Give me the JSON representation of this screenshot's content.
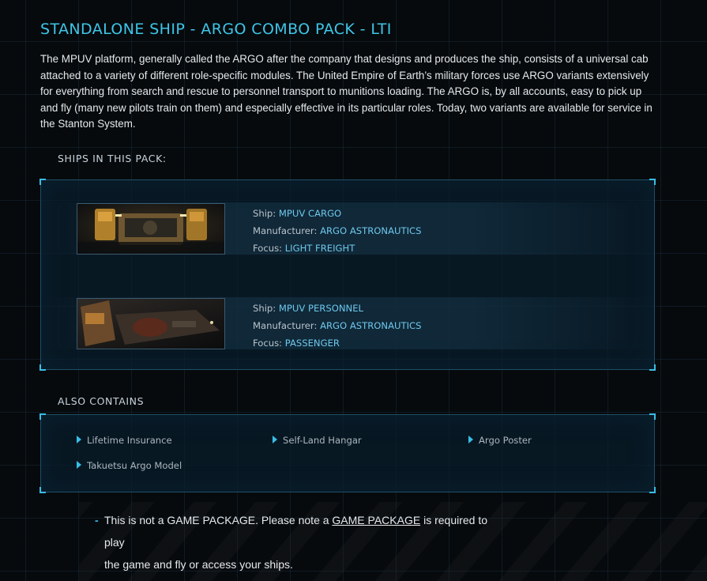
{
  "header": {
    "title": "STANDALONE SHIP - ARGO COMBO PACK - LTI",
    "description": "The MPUV platform, generally called the ARGO after the company that designs and produces the ship, consists of a universal cab attached to a variety of different role-specific modules. The United Empire of Earth’s military forces use ARGO variants extensively for everything from search and rescue to personnel transport to munitions loading. The ARGO is, by all accounts, easy to pick up and fly (many new pilots train on them) and especially effective in its particular roles. Today, two variants are available for service in the Stanton System."
  },
  "ships_section": {
    "label": "SHIPS IN THIS PACK:",
    "ship_key": "Ship: ",
    "manufacturer_key": "Manufacturer: ",
    "focus_key": "Focus: ",
    "ships": [
      {
        "ship": "MPUV CARGO",
        "manufacturer": "ARGO ASTRONAUTICS",
        "focus": "LIGHT FREIGHT"
      },
      {
        "ship": "MPUV PERSONNEL",
        "manufacturer": "ARGO ASTRONAUTICS",
        "focus": "PASSENGER"
      }
    ]
  },
  "contains_section": {
    "label": "ALSO CONTAINS",
    "items": [
      "Lifetime Insurance",
      "Self-Land Hangar",
      "Argo Poster",
      "Takuetsu Argo Model"
    ]
  },
  "note": {
    "line1_before": "This is not a GAME PACKAGE. Please note a ",
    "link": "GAME PACKAGE",
    "line1_after": " is required to play",
    "line2": "the game and fly or access your ships."
  },
  "colors": {
    "accent": "#3ec6e8",
    "value_text": "#6ec8ec",
    "background": "#060a0d"
  }
}
